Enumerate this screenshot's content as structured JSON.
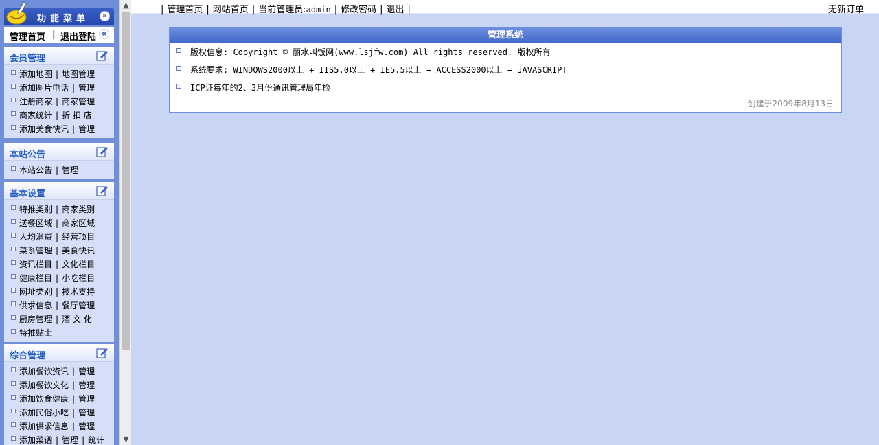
{
  "left_menu": {
    "header_title": "功能菜单",
    "quick": {
      "home": "管理首页",
      "sep": "|",
      "logout": "退出登陆"
    },
    "sections": [
      {
        "title": "会员管理",
        "rows": [
          [
            "添加地图",
            "地图管理"
          ],
          [
            "添加图片电话",
            "管理"
          ],
          [
            "注册商家",
            "商家管理"
          ],
          [
            "商家统计",
            "折 扣 店"
          ],
          [
            "添加美食快讯",
            "管理"
          ]
        ]
      },
      {
        "title": "本站公告",
        "rows": [
          [
            "本站公告",
            "管理"
          ]
        ]
      },
      {
        "title": "基本设置",
        "rows": [
          [
            "特推类别",
            "商家类别"
          ],
          [
            "送餐区域",
            "商家区域"
          ],
          [
            "人均消费",
            "经营项目"
          ],
          [
            "菜系管理",
            "美食快讯"
          ],
          [
            "资讯栏目",
            "文化栏目"
          ],
          [
            "健康栏目",
            "小吃栏目"
          ],
          [
            "网址类别",
            "技术支持"
          ],
          [
            "供求信息",
            "餐厅管理"
          ],
          [
            "厨房管理",
            "酒 文 化"
          ],
          [
            "特推贴士"
          ]
        ]
      },
      {
        "title": "综合管理",
        "rows": [
          [
            "添加餐饮资讯",
            "管理"
          ],
          [
            "添加餐饮文化",
            "管理"
          ],
          [
            "添加饮食健康",
            "管理"
          ],
          [
            "添加民俗小吃",
            "管理"
          ],
          [
            "添加供求信息",
            "管理"
          ],
          [
            "添加菜谱",
            "管理",
            "统计"
          ]
        ]
      }
    ]
  },
  "topbar": {
    "sep": "|",
    "admin_home": "管理首页",
    "site_home": "网站首页",
    "current_admin_label": "当前管理员:",
    "admin_name": "admin",
    "change_password": "修改密码",
    "logout": "退出",
    "no_new_orders": "无新订单"
  },
  "main_box": {
    "title": "管理系统",
    "items": [
      "版权信息: Copyright © 丽水叫饭网(www.lsjfw.com) All rights reserved. 版权所有",
      "系统要求: WINDOWS2000以上 + IIS5.0以上 + IE5.5以上 + ACCESS2000以上 + JAVASCRIPT",
      "ICP证每年的2、3月份通讯管理局年检"
    ],
    "created": "创建于2009年8月13日"
  },
  "icons": {
    "logo": "broom-logo-icon",
    "collapse": "chevron-double-down-icon",
    "back": "chevron-double-left-icon",
    "section_edit": "edit-pencil-icon",
    "bullet": "square-bullet-icon"
  },
  "colors": {
    "page_bg": "#c8d5f4",
    "sidebar_bg": "#6f8fd8",
    "header_blue": "#2547ab",
    "section_title": "#215dc6"
  }
}
